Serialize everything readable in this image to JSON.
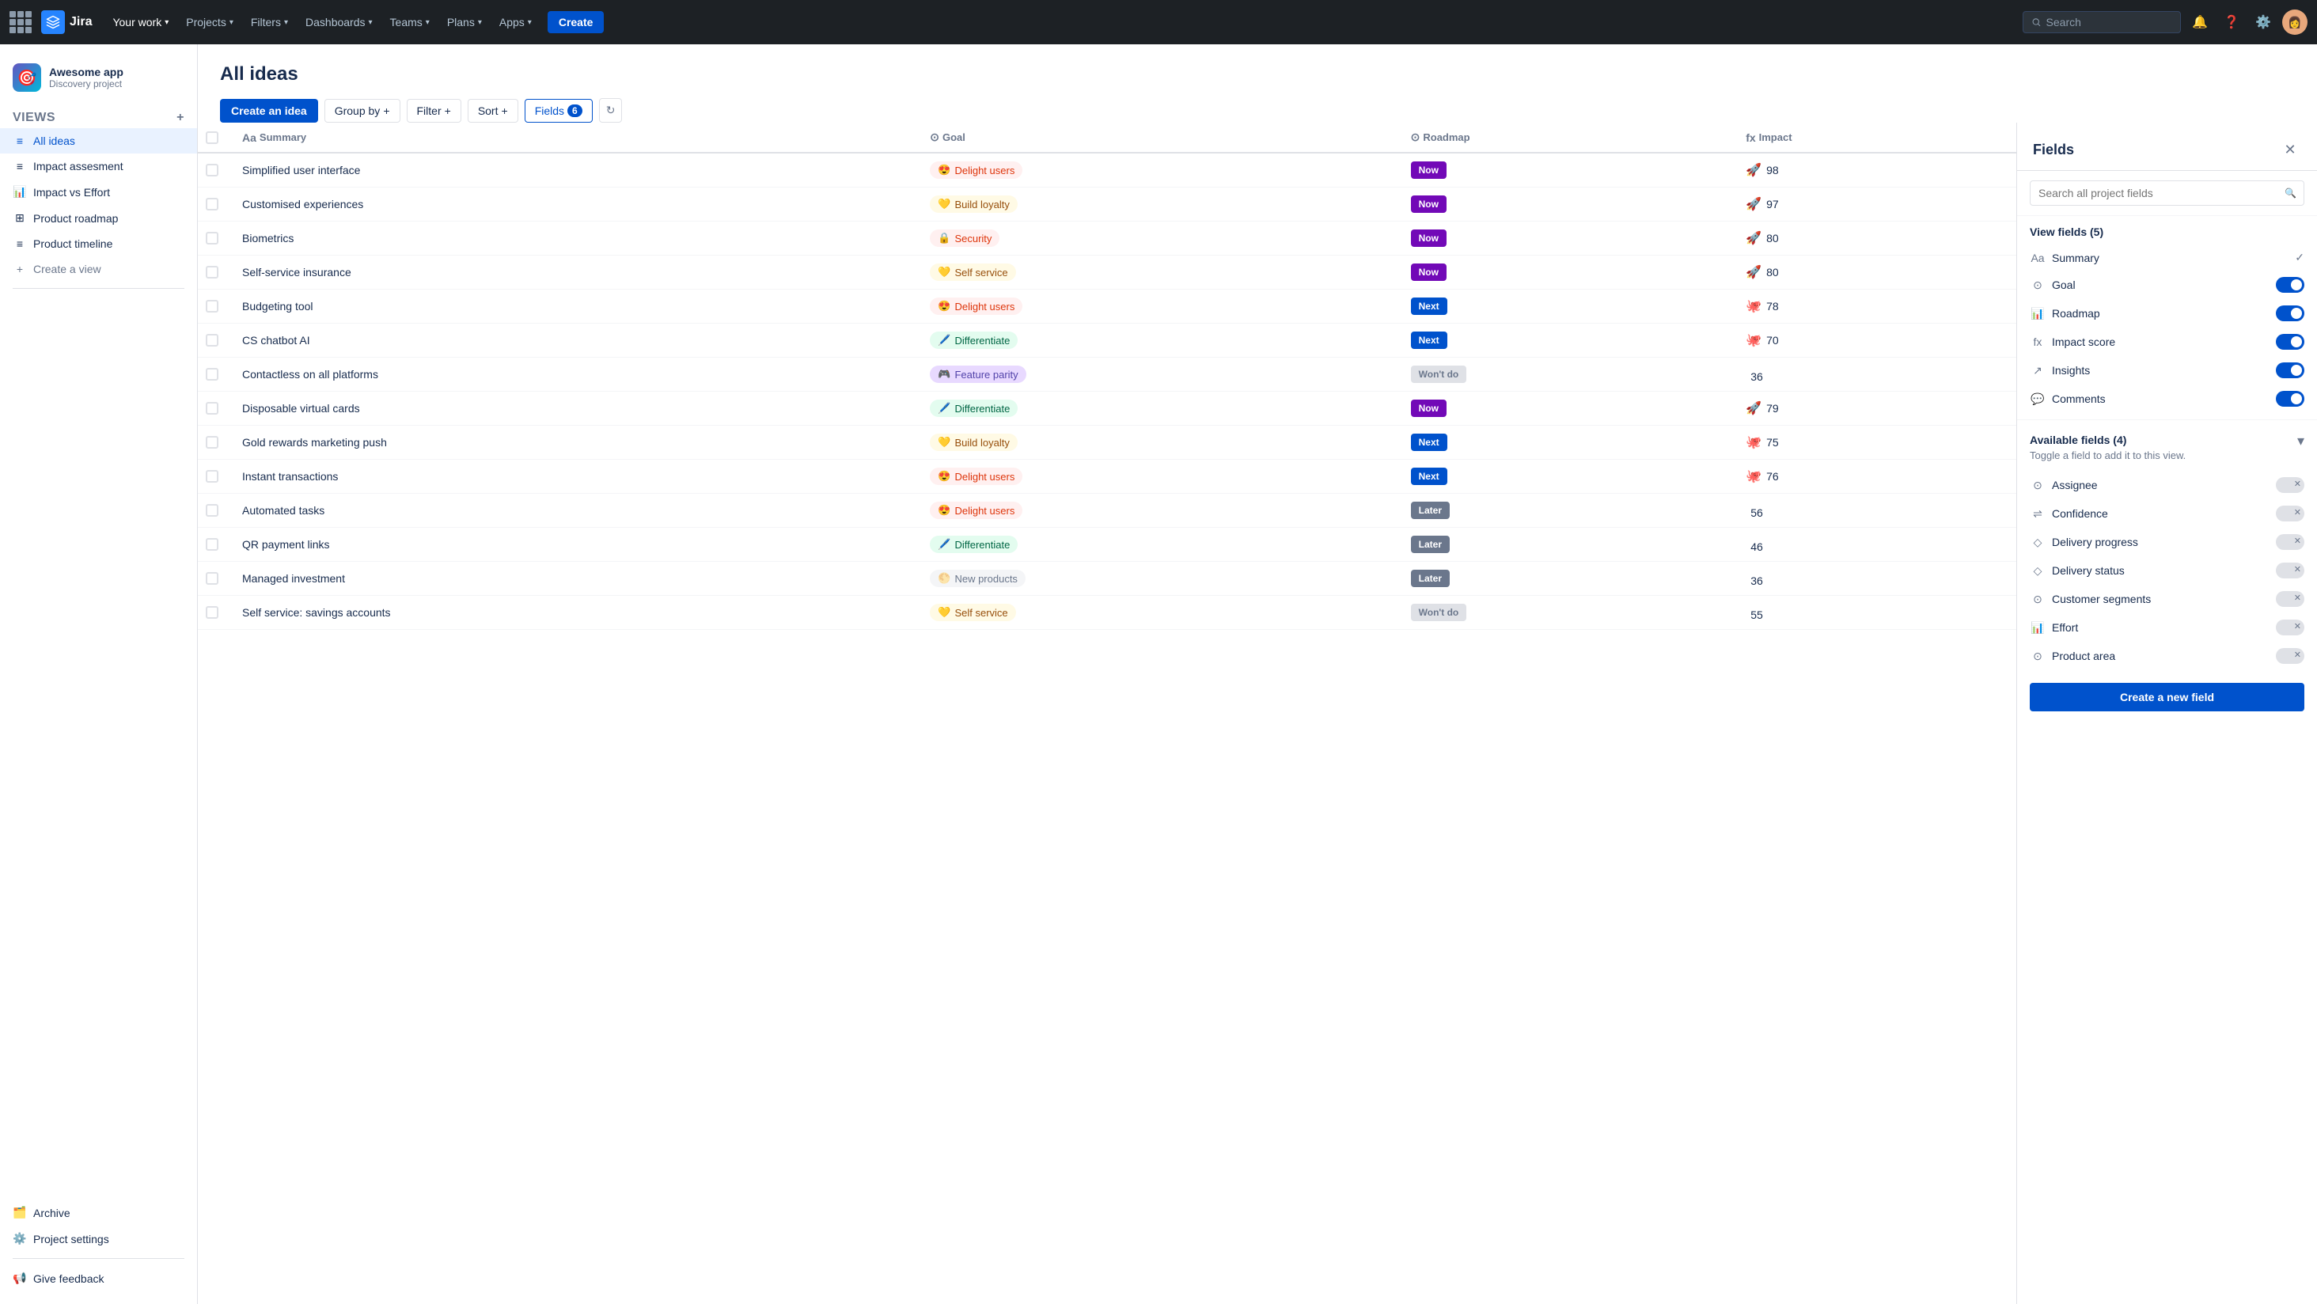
{
  "topnav": {
    "logo_text": "Jira",
    "nav_items": [
      {
        "label": "Your work",
        "active": false
      },
      {
        "label": "Projects",
        "active": true
      },
      {
        "label": "Filters",
        "active": false
      },
      {
        "label": "Dashboards",
        "active": false
      },
      {
        "label": "Teams",
        "active": false
      },
      {
        "label": "Plans",
        "active": false
      },
      {
        "label": "Apps",
        "active": false
      }
    ],
    "create_label": "Create",
    "search_placeholder": "Search"
  },
  "sidebar": {
    "project_icon": "🎯",
    "project_name": "Awesome app",
    "project_type": "Discovery project",
    "views_label": "VIEWS",
    "views": [
      {
        "label": "All ideas",
        "icon": "≡",
        "active": true
      },
      {
        "label": "Impact assesment",
        "icon": "≡",
        "active": false
      },
      {
        "label": "Impact vs Effort",
        "icon": "📊",
        "active": false
      },
      {
        "label": "Product roadmap",
        "icon": "⊞",
        "active": false
      },
      {
        "label": "Product timeline",
        "icon": "≡",
        "active": false
      }
    ],
    "create_view_label": "Create a view",
    "archive_label": "Archive",
    "project_settings_label": "Project settings",
    "give_feedback_label": "Give feedback"
  },
  "main": {
    "title": "All ideas",
    "toolbar": {
      "create_idea": "Create an idea",
      "group_by": "Group by",
      "filter": "Filter",
      "sort": "Sort",
      "fields": "Fields",
      "fields_count": "6"
    },
    "table": {
      "columns": [
        "Summary",
        "Goal",
        "Roadmap",
        "Impact"
      ],
      "rows": [
        {
          "summary": "Simplified user interface",
          "goal": "Delight users",
          "goal_type": "delight",
          "goal_emoji": "😍",
          "roadmap": "Now",
          "roadmap_type": "now",
          "impact": 98,
          "impact_icon": "🚀"
        },
        {
          "summary": "Customised experiences",
          "goal": "Build loyalty",
          "goal_type": "build",
          "goal_emoji": "💛",
          "roadmap": "Now",
          "roadmap_type": "now",
          "impact": 97,
          "impact_icon": "🚀"
        },
        {
          "summary": "Biometrics",
          "goal": "Security",
          "goal_type": "security",
          "goal_emoji": "🔒",
          "roadmap": "Now",
          "roadmap_type": "now",
          "impact": 80,
          "impact_icon": "🚀"
        },
        {
          "summary": "Self-service insurance",
          "goal": "Self service",
          "goal_type": "selfservice",
          "goal_emoji": "💛",
          "roadmap": "Now",
          "roadmap_type": "now",
          "impact": 80,
          "impact_icon": "🚀"
        },
        {
          "summary": "Budgeting tool",
          "goal": "Delight users",
          "goal_type": "delight",
          "goal_emoji": "😍",
          "roadmap": "Next",
          "roadmap_type": "next",
          "impact": 78,
          "impact_icon": "🐙"
        },
        {
          "summary": "CS chatbot AI",
          "goal": "Differentiate",
          "goal_type": "differentiate",
          "goal_emoji": "🖊️",
          "roadmap": "Next",
          "roadmap_type": "next",
          "impact": 70,
          "impact_icon": "🐙"
        },
        {
          "summary": "Contactless on all platforms",
          "goal": "Feature parity",
          "goal_type": "featureparity",
          "goal_emoji": "🎮",
          "roadmap": "Won't do",
          "roadmap_type": "wontdo",
          "impact": 36,
          "impact_icon": ""
        },
        {
          "summary": "Disposable virtual cards",
          "goal": "Differentiate",
          "goal_type": "differentiate",
          "goal_emoji": "🖊️",
          "roadmap": "Now",
          "roadmap_type": "now",
          "impact": 79,
          "impact_icon": "🚀"
        },
        {
          "summary": "Gold rewards marketing push",
          "goal": "Build loyalty",
          "goal_type": "build",
          "goal_emoji": "💛",
          "roadmap": "Next",
          "roadmap_type": "next",
          "impact": 75,
          "impact_icon": "🐙"
        },
        {
          "summary": "Instant transactions",
          "goal": "Delight users",
          "goal_type": "delight",
          "goal_emoji": "😍",
          "roadmap": "Next",
          "roadmap_type": "next",
          "impact": 76,
          "impact_icon": "🐙"
        },
        {
          "summary": "Automated tasks",
          "goal": "Delight users",
          "goal_type": "delight",
          "goal_emoji": "😍",
          "roadmap": "Later",
          "roadmap_type": "later",
          "impact": 56,
          "impact_icon": ""
        },
        {
          "summary": "QR payment links",
          "goal": "Differentiate",
          "goal_type": "differentiate",
          "goal_emoji": "🖊️",
          "roadmap": "Later",
          "roadmap_type": "later",
          "impact": 46,
          "impact_icon": ""
        },
        {
          "summary": "Managed investment",
          "goal": "New products",
          "goal_type": "newproducts",
          "goal_emoji": "🌕",
          "roadmap": "Later",
          "roadmap_type": "later",
          "impact": 36,
          "impact_icon": ""
        },
        {
          "summary": "Self service: savings accounts",
          "goal": "Self service",
          "goal_type": "selfservice",
          "goal_emoji": "💛",
          "roadmap": "Won't do",
          "roadmap_type": "wontdo",
          "impact": 55,
          "impact_icon": ""
        }
      ]
    }
  },
  "fields_panel": {
    "title": "Fields",
    "search_placeholder": "Search all project fields",
    "view_fields_label": "View fields (5)",
    "view_fields": [
      {
        "name": "Summary",
        "icon": "Aa",
        "enabled": "check"
      },
      {
        "name": "Goal",
        "icon": "⊙",
        "enabled": true
      },
      {
        "name": "Roadmap",
        "icon": "📊",
        "enabled": true
      },
      {
        "name": "Impact score",
        "icon": "fx",
        "enabled": true
      },
      {
        "name": "Insights",
        "icon": "↗",
        "enabled": true
      },
      {
        "name": "Comments",
        "icon": "💬",
        "enabled": true
      }
    ],
    "available_fields_label": "Available fields (4)",
    "available_fields_subtitle": "Toggle a field to add it to this view.",
    "available_fields": [
      {
        "name": "Assignee",
        "icon": "⊙"
      },
      {
        "name": "Confidence",
        "icon": "⇌"
      },
      {
        "name": "Delivery progress",
        "icon": "◇"
      },
      {
        "name": "Delivery status",
        "icon": "◇"
      },
      {
        "name": "Customer segments",
        "icon": "⊙"
      },
      {
        "name": "Effort",
        "icon": "📊"
      },
      {
        "name": "Product area",
        "icon": "⊙"
      }
    ],
    "create_new_field": "Create a new field"
  }
}
